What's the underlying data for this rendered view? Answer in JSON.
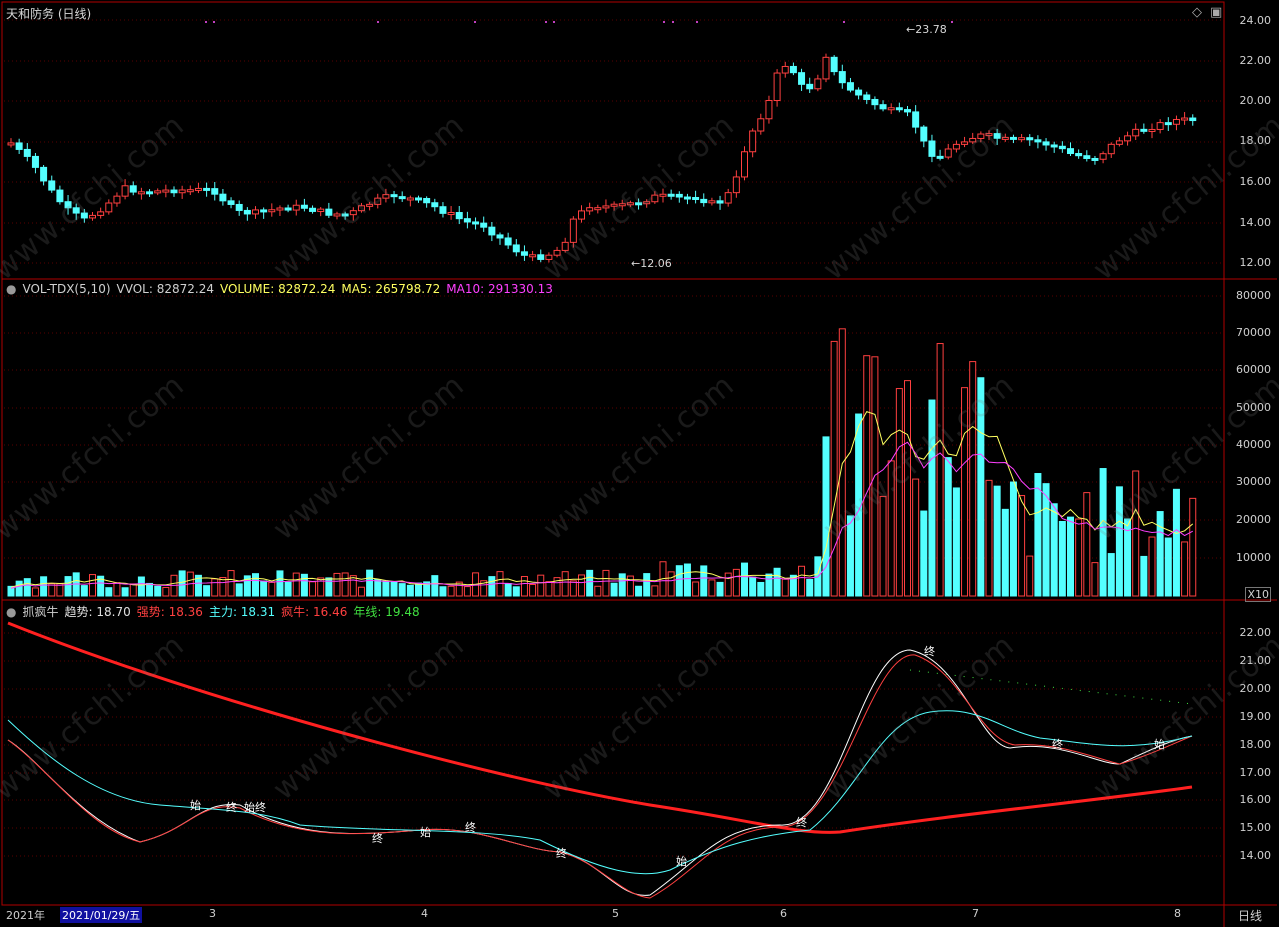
{
  "window": {
    "title": "天和防务 (日线)",
    "period_label": "日线"
  },
  "price_panel": {
    "high_label": "23.78",
    "low_label": "12.06",
    "y_ticks": [
      "24.00",
      "22.00",
      "20.00",
      "18.00",
      "16.00",
      "14.00",
      "12.00"
    ]
  },
  "volume_panel": {
    "indicator": "VOL-TDX(5,10)",
    "vvol": "VVOL: 82872.24",
    "volume": "VOLUME: 82872.24",
    "ma5": "MA5: 265798.72",
    "ma10": "MA10: 291330.13",
    "y_ticks": [
      "80000",
      "70000",
      "60000",
      "50000",
      "40000",
      "30000",
      "20000",
      "10000"
    ],
    "unit": "X10"
  },
  "indicator_panel": {
    "name": "抓疯牛",
    "trend": "趋势: 18.70",
    "strong": "强势: 18.36",
    "main": "主力: 18.31",
    "crazy": "疯牛: 16.46",
    "year": "年线: 19.48",
    "y_ticks": [
      "22.00",
      "21.00",
      "20.00",
      "19.00",
      "18.00",
      "17.00",
      "16.00",
      "15.00",
      "14.00"
    ],
    "markers": [
      "始",
      "终",
      "始终",
      "终",
      "始",
      "终",
      "终",
      "始",
      "终",
      "终",
      "终",
      "始"
    ]
  },
  "x_axis": {
    "year": "2021年",
    "cursor_date": "2021/01/29/五",
    "months": [
      "3",
      "4",
      "5",
      "6",
      "7",
      "8"
    ]
  },
  "watermark": "www.cfchi.com",
  "colors": {
    "up": "#ff4040",
    "down": "#54ffff",
    "ma5": "#ffff60",
    "ma10": "#ff40ff",
    "year_line": "#ff2020",
    "frame": "#b00000",
    "label_yellow": "#ffff60",
    "label_magenta": "#ff40ff",
    "label_red": "#ff4040",
    "label_cyan": "#54ffff",
    "label_green": "#40e040"
  }
}
